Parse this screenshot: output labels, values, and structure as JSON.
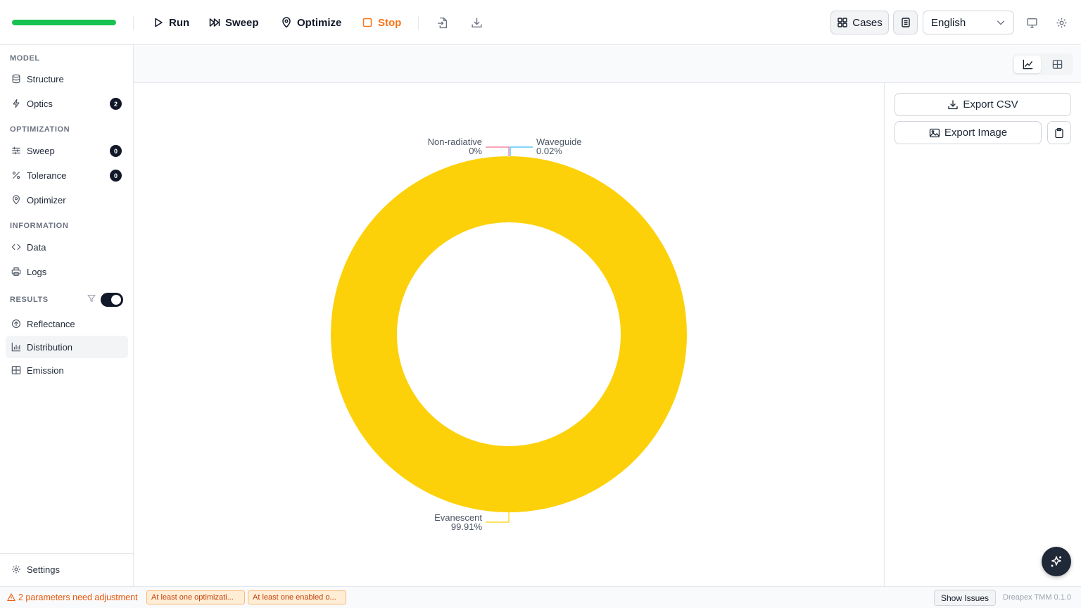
{
  "progress": {
    "value": 1.0,
    "color": "#16c250"
  },
  "toolbar": {
    "run": "Run",
    "sweep": "Sweep",
    "optimize": "Optimize",
    "stop": "Stop",
    "cases": "Cases",
    "language": "English"
  },
  "sidebar": {
    "model_title": "MODEL",
    "structure": "Structure",
    "optics": "Optics",
    "optics_badge": "2",
    "optimization_title": "OPTIMIZATION",
    "sweep": "Sweep",
    "sweep_badge": "0",
    "tolerance": "Tolerance",
    "tolerance_badge": "0",
    "optimizer": "Optimizer",
    "information_title": "INFORMATION",
    "data": "Data",
    "logs": "Logs",
    "results_title": "RESULTS",
    "results_toggle": true,
    "reflectance": "Reflectance",
    "distribution": "Distribution",
    "emission": "Emission",
    "settings": "Settings"
  },
  "panel": {
    "export_csv": "Export CSV",
    "export_image": "Export Image"
  },
  "chart_data": {
    "type": "pie",
    "variant": "donut",
    "slices": [
      {
        "name": "Evanescent",
        "value": 99.91,
        "label": "99.91%",
        "color": "#fcd10a"
      },
      {
        "name": "Non-radiative",
        "value": 0.0,
        "label": "0%",
        "color": "#f8718e"
      },
      {
        "name": "Waveguide",
        "value": 0.02,
        "label": "0.02%",
        "color": "#38bdf8"
      }
    ]
  },
  "status": {
    "warning": "2 parameters need adjustment",
    "chip1": "At least one optimizati...",
    "chip2": "At least one enabled o...",
    "show_issues": "Show Issues",
    "version": "Dreapex TMM 0.1.0"
  }
}
